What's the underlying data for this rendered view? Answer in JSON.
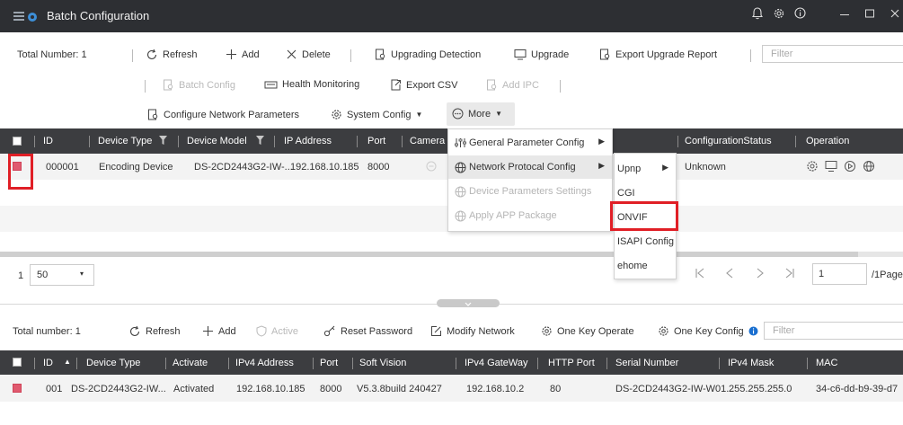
{
  "window": {
    "title": "Batch Configuration"
  },
  "toolbar": {
    "total": "Total Number: 1",
    "refresh": "Refresh",
    "add": "Add",
    "delete": "Delete",
    "upgrading_detection": "Upgrading Detection",
    "upgrade": "Upgrade",
    "export_upgrade_report": "Export Upgrade Report",
    "filter_placeholder": "Filter",
    "batch_config": "Batch Config",
    "health_monitoring": "Health Monitoring",
    "export_csv": "Export CSV",
    "add_ipc": "Add IPC",
    "configure_network_parameters": "Configure Network Parameters",
    "system_config": "System Config",
    "more": "More"
  },
  "grid1": {
    "headers": {
      "id": "ID",
      "device_type": "Device Type",
      "device_model": "Device Model",
      "ip_address": "IP Address",
      "port": "Port",
      "camera": "Camera",
      "configuration_status": "ConfigurationStatus",
      "operation": "Operation"
    },
    "rows": [
      {
        "id": "000001",
        "device_type": "Encoding Device",
        "device_model": "DS-2CD2443G2-IW-...",
        "ip_address": "192.168.10.185",
        "port": "8000",
        "configuration_status": "Unknown"
      }
    ]
  },
  "more_menu": {
    "items": [
      {
        "label": "General Parameter Config",
        "enabled": true
      },
      {
        "label": "Network Protocal Config",
        "enabled": true
      },
      {
        "label": "Device Parameters Settings",
        "enabled": false
      },
      {
        "label": "Apply APP Package",
        "enabled": false
      }
    ]
  },
  "sub_menu": {
    "items": [
      {
        "label": "Upnp"
      },
      {
        "label": "CGI"
      },
      {
        "label": "ONVIF"
      },
      {
        "label": "ISAPI Config"
      },
      {
        "label": "ehome"
      }
    ]
  },
  "pager": {
    "current": "1",
    "page_size": "50",
    "page_input": "1",
    "page_total": "/1Page"
  },
  "bottom_toolbar": {
    "total": "Total number: 1",
    "refresh": "Refresh",
    "add": "Add",
    "active": "Active",
    "reset_password": "Reset Password",
    "modify_network": "Modify Network",
    "one_key_operate": "One Key Operate",
    "one_key_config": "One Key Config",
    "filter_placeholder": "Filter"
  },
  "grid2": {
    "headers": {
      "id": "ID",
      "device_type": "Device Type",
      "activate": "Activate",
      "ipv4_address": "IPv4 Address",
      "port": "Port",
      "soft_vision": "Soft Vision",
      "ipv4_gateway": "IPv4 GateWay",
      "http_port": "HTTP Port",
      "serial_number": "Serial Number",
      "ipv4_mask": "IPv4 Mask",
      "mac": "MAC"
    },
    "rows": [
      {
        "id": "001",
        "device_type": "DS-2CD2443G2-IW...",
        "activate": "Activated",
        "ipv4_address": "192.168.10.185",
        "port": "8000",
        "soft_vision": "V5.3.8build 240427",
        "ipv4_gateway": "192.168.10.2",
        "http_port": "80",
        "serial_number": "DS-2CD2443G2-IW-W01...",
        "ipv4_mask": "255.255.255.0",
        "mac": "34-c6-dd-b9-39-d7"
      }
    ]
  },
  "colors": {
    "titlebar": "#2d2f33",
    "header": "#3c3d40",
    "highlight": "#e01f26",
    "checkbox": "#e05a6f",
    "info": "#1a6fd0"
  }
}
